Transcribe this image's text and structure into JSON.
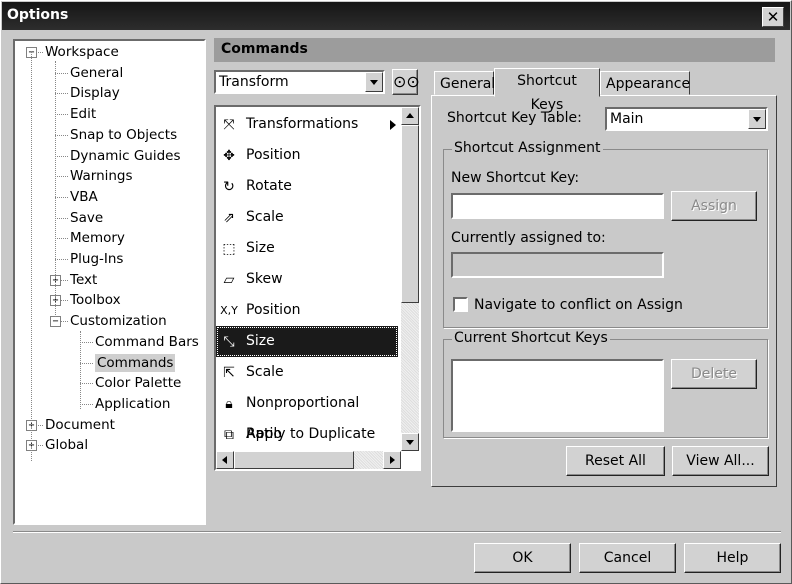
{
  "window": {
    "title": "Options",
    "close_glyph": "✕"
  },
  "tree": {
    "items": [
      {
        "label": "Workspace",
        "expander": "−"
      },
      {
        "label": "General"
      },
      {
        "label": "Display"
      },
      {
        "label": "Edit"
      },
      {
        "label": "Snap to Objects"
      },
      {
        "label": "Dynamic Guides"
      },
      {
        "label": "Warnings"
      },
      {
        "label": "VBA"
      },
      {
        "label": "Save"
      },
      {
        "label": "Memory"
      },
      {
        "label": "Plug-Ins"
      },
      {
        "label": "Text",
        "expander": "+"
      },
      {
        "label": "Toolbox",
        "expander": "+"
      },
      {
        "label": "Customization",
        "expander": "−"
      },
      {
        "label": "Command Bars"
      },
      {
        "label": "Commands",
        "selected": true
      },
      {
        "label": "Color Palette"
      },
      {
        "label": "Application"
      },
      {
        "label": "Document",
        "expander": "+"
      },
      {
        "label": "Global",
        "expander": "+"
      }
    ]
  },
  "header": {
    "title": "Commands"
  },
  "category_combo": {
    "value": "Transform"
  },
  "find_icon": "binoculars-icon",
  "commands": [
    {
      "label": "Transformations",
      "icon": "transform-icon",
      "glyph": "⤧",
      "submenu": true
    },
    {
      "label": "Position",
      "icon": "move-icon",
      "glyph": "✥"
    },
    {
      "label": "Rotate",
      "icon": "rotate-icon",
      "glyph": "↻"
    },
    {
      "label": "Scale",
      "icon": "scale-icon",
      "glyph": "⇗"
    },
    {
      "label": "Size",
      "icon": "size-icon",
      "glyph": "⬚"
    },
    {
      "label": "Skew",
      "icon": "skew-icon",
      "glyph": "▱"
    },
    {
      "label": "Position",
      "icon": "xy-position-icon",
      "glyph": "X,Y"
    },
    {
      "label": "Size",
      "icon": "size-select-icon",
      "glyph": "⤡",
      "selected": true
    },
    {
      "label": "Scale",
      "icon": "scale-xy-icon",
      "glyph": "⇱"
    },
    {
      "label": "Nonproportional Ratio",
      "icon": "lock-ratio-icon",
      "glyph": "🔒︎"
    },
    {
      "label": "Apply to Duplicate",
      "icon": "duplicate-icon",
      "glyph": "⧉"
    }
  ],
  "tabs": [
    "General",
    "Shortcut Keys",
    "Appearance"
  ],
  "active_tab": "Shortcut Keys",
  "shortcut": {
    "table_label": "Shortcut Key Table:",
    "table_value": "Main",
    "assignment_group": "Shortcut Assignment",
    "new_key_label": "New Shortcut Key:",
    "new_key_value": "",
    "assign_button": "Assign",
    "assigned_to_label": "Currently assigned to:",
    "assigned_to_value": "",
    "navigate_label": "Navigate to conflict on Assign",
    "navigate_checked": false,
    "current_group": "Current Shortcut Keys",
    "delete_button": "Delete",
    "reset_all_button": "Reset All",
    "view_all_button": "View All..."
  },
  "footer": {
    "ok": "OK",
    "cancel": "Cancel",
    "help": "Help"
  }
}
